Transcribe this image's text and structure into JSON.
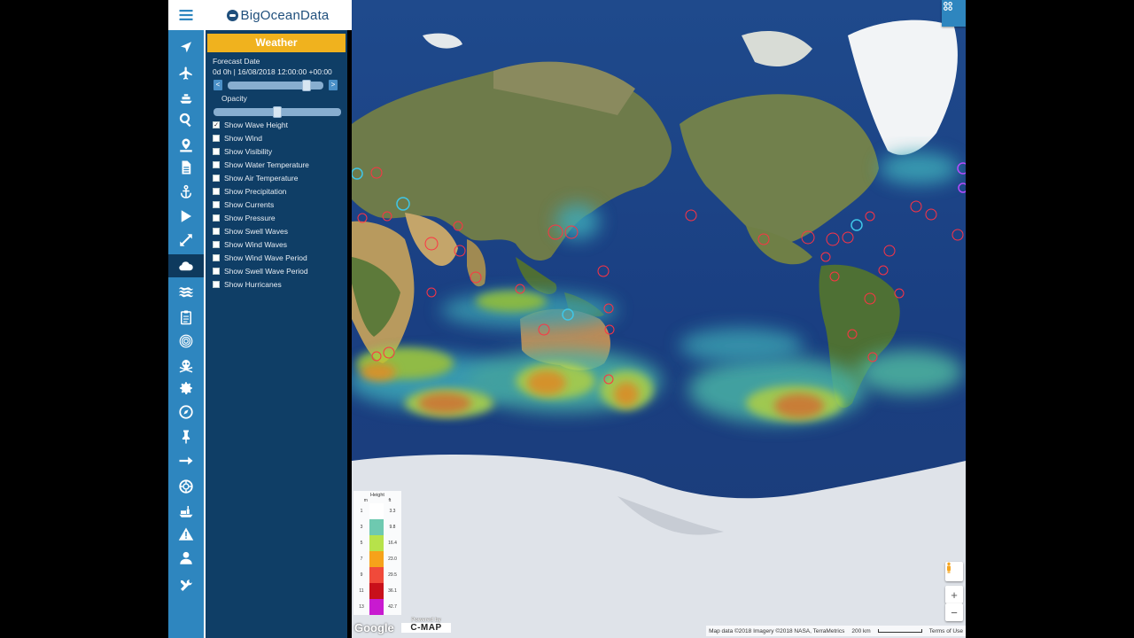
{
  "brand": {
    "name": "BigOceanData"
  },
  "panel": {
    "title": "Weather",
    "forecast_label": "Forecast Date",
    "forecast_value": "0d 0h | 16/08/2018 12:00:00 +00:00",
    "prev_label": "<",
    "next_label": ">",
    "opacity_label": "Opacity",
    "forecast_position": 0.86,
    "opacity_position": 0.5,
    "options": [
      {
        "label": "Show Wave Height",
        "checked": true
      },
      {
        "label": "Show Wind",
        "checked": false
      },
      {
        "label": "Show Visibility",
        "checked": false
      },
      {
        "label": "Show Water Temperature",
        "checked": false
      },
      {
        "label": "Show Air Temperature",
        "checked": false
      },
      {
        "label": "Show Precipitation",
        "checked": false
      },
      {
        "label": "Show Currents",
        "checked": false
      },
      {
        "label": "Show Pressure",
        "checked": false
      },
      {
        "label": "Show Swell Waves",
        "checked": false
      },
      {
        "label": "Show Wind Waves",
        "checked": false
      },
      {
        "label": "Show Wind Wave Period",
        "checked": false
      },
      {
        "label": "Show Swell Wave Period",
        "checked": false
      },
      {
        "label": "Show Hurricanes",
        "checked": false
      }
    ]
  },
  "rail": {
    "icons": [
      "navigation-arrow-icon",
      "airplane-icon",
      "ship-icon",
      "search-icon",
      "map-pin-icon",
      "document-icon",
      "anchor-icon",
      "play-icon",
      "expand-icon",
      "cloud-icon",
      "waves-icon",
      "clipboard-icon",
      "radar-icon",
      "skull-icon",
      "gear-icon",
      "compass-icon",
      "pushpin-icon",
      "arrow-right-icon",
      "lifebuoy-icon",
      "tanker-icon",
      "warning-icon",
      "user-icon",
      "tools-icon"
    ],
    "active": "cloud-icon"
  },
  "legend": {
    "title": "Height",
    "unit_m": "m",
    "unit_ft": "ft",
    "rows": [
      {
        "m": "1",
        "ft": "3.3",
        "color": "#ffffff"
      },
      {
        "m": "3",
        "ft": "9.8",
        "color": "#6ec9b0"
      },
      {
        "m": "5",
        "ft": "16.4",
        "color": "#b7e24a"
      },
      {
        "m": "7",
        "ft": "23.0",
        "color": "#f6a21a"
      },
      {
        "m": "9",
        "ft": "29.5",
        "color": "#f04a3a"
      },
      {
        "m": "11",
        "ft": "36.1",
        "color": "#c8101a"
      },
      {
        "m": "13",
        "ft": "42.7",
        "color": "#c81ad0"
      }
    ]
  },
  "map": {
    "attribution": "Map data ©2018 Imagery ©2018 NASA, TerraMetrics",
    "scale": "200 km",
    "terms": "Terms of Use",
    "google": "Google",
    "powered_by": "Powered by",
    "cmap": "C-MAP",
    "zoom_in": "+",
    "zoom_out": "−"
  }
}
